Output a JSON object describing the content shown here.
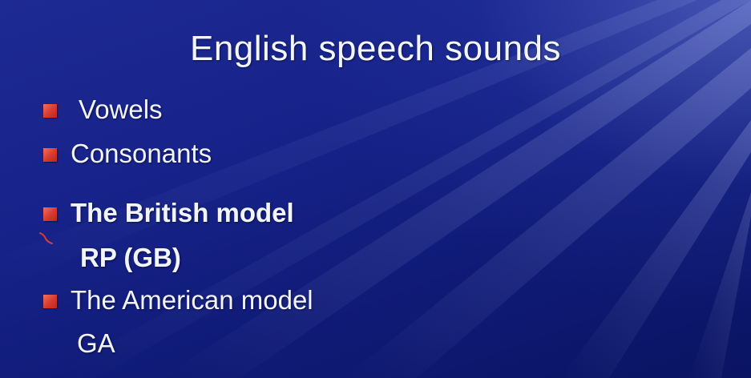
{
  "slide": {
    "title": "English speech sounds",
    "bullets": [
      {
        "label": "Vowels"
      },
      {
        "label": "Consonants"
      },
      {
        "label": "The British model",
        "sub": "RP (GB)"
      },
      {
        "label": "The American model",
        "sub": "GA"
      }
    ]
  },
  "colors": {
    "background": "#17238a",
    "bullet": "#d8392e",
    "text": "#f2f4ff"
  },
  "icons": {
    "bullet": "square-bullet-icon",
    "mark": "pen-mark-icon"
  }
}
